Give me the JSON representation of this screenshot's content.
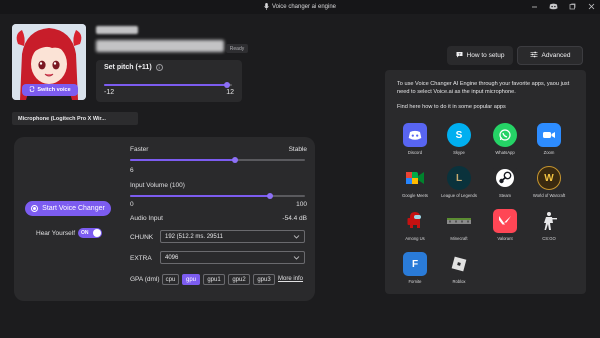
{
  "window": {
    "title": "Voice changer ai engine",
    "controls": [
      "minimize-icon",
      "discord-icon",
      "maximize-icon",
      "close-icon"
    ]
  },
  "voice": {
    "switch_label": "Switch voice",
    "status_badge": "Ready"
  },
  "pitch": {
    "label": "Set pitch (+11)",
    "min": "-12",
    "max": "12",
    "value": 11
  },
  "microphone": {
    "selected": "Microphone (Logitech Pro X Wir..."
  },
  "controls": {
    "start_label": "Start Voice Changer",
    "hear_label": "Hear Yourself",
    "hear_toggle": "ON",
    "faster_label": "Faster",
    "stable_label": "Stable",
    "speed_value": "6",
    "speed_fraction": 0.6,
    "input_volume_label": "Input Volume (100)",
    "input_volume_min": "0",
    "input_volume_max": "100",
    "input_volume_fraction": 1.0,
    "audio_input_label": "Audio Input",
    "audio_input_value": "-54.4 dB",
    "chunk_label": "CHUNK",
    "chunk_value": "192 (512.2 ms. 29511",
    "extra_label": "EXTRA",
    "extra_value": "4096",
    "gpa_label": "GPA (dml)",
    "gpu_options": [
      "cpu",
      "gpu",
      "gpu1",
      "gpu2",
      "gpu3"
    ],
    "gpu_selected": "gpu",
    "more_info": "More info"
  },
  "top_buttons": {
    "setup": "How to setup",
    "advanced": "Advanced"
  },
  "apps": {
    "intro": "To use Voice Changer AI Engine through your favorite apps, yaou just need to select Voice.ai as the input microphone.",
    "subheading": "Find here how to do it in some popular apps",
    "items": [
      {
        "name": "Discord",
        "color": "#5865f2",
        "icon": "discord-icon"
      },
      {
        "name": "Skype",
        "color": "#00aff0",
        "icon": "skype-icon"
      },
      {
        "name": "WhatsApp",
        "color": "#25d366",
        "icon": "whatsapp-icon"
      },
      {
        "name": "Zoom",
        "color": "#2d8cff",
        "icon": "zoom-icon"
      },
      {
        "name": "Google Meets",
        "color": "#00897b",
        "icon": "google-meet-icon"
      },
      {
        "name": "League of Legends",
        "color": "#0a323c",
        "icon": "league-of-legends-icon"
      },
      {
        "name": "Steam",
        "color": "#171a21",
        "icon": "steam-icon"
      },
      {
        "name": "World of Warcraft",
        "color": "#3a2a10",
        "icon": "world-of-warcraft-icon"
      },
      {
        "name": "Among Us",
        "color": "#c51111",
        "icon": "among-us-icon"
      },
      {
        "name": "Minecraft",
        "color": "#5b8c32",
        "icon": "minecraft-icon"
      },
      {
        "name": "Valorant",
        "color": "#ff4655",
        "icon": "valorant-icon"
      },
      {
        "name": "CS:GO",
        "color": "#1b1b1b",
        "icon": "csgo-icon"
      },
      {
        "name": "Fornite",
        "color": "#2a7bd8",
        "icon": "fortnite-icon"
      },
      {
        "name": "Roblox",
        "color": "#e2e2e2",
        "icon": "roblox-icon"
      }
    ]
  }
}
